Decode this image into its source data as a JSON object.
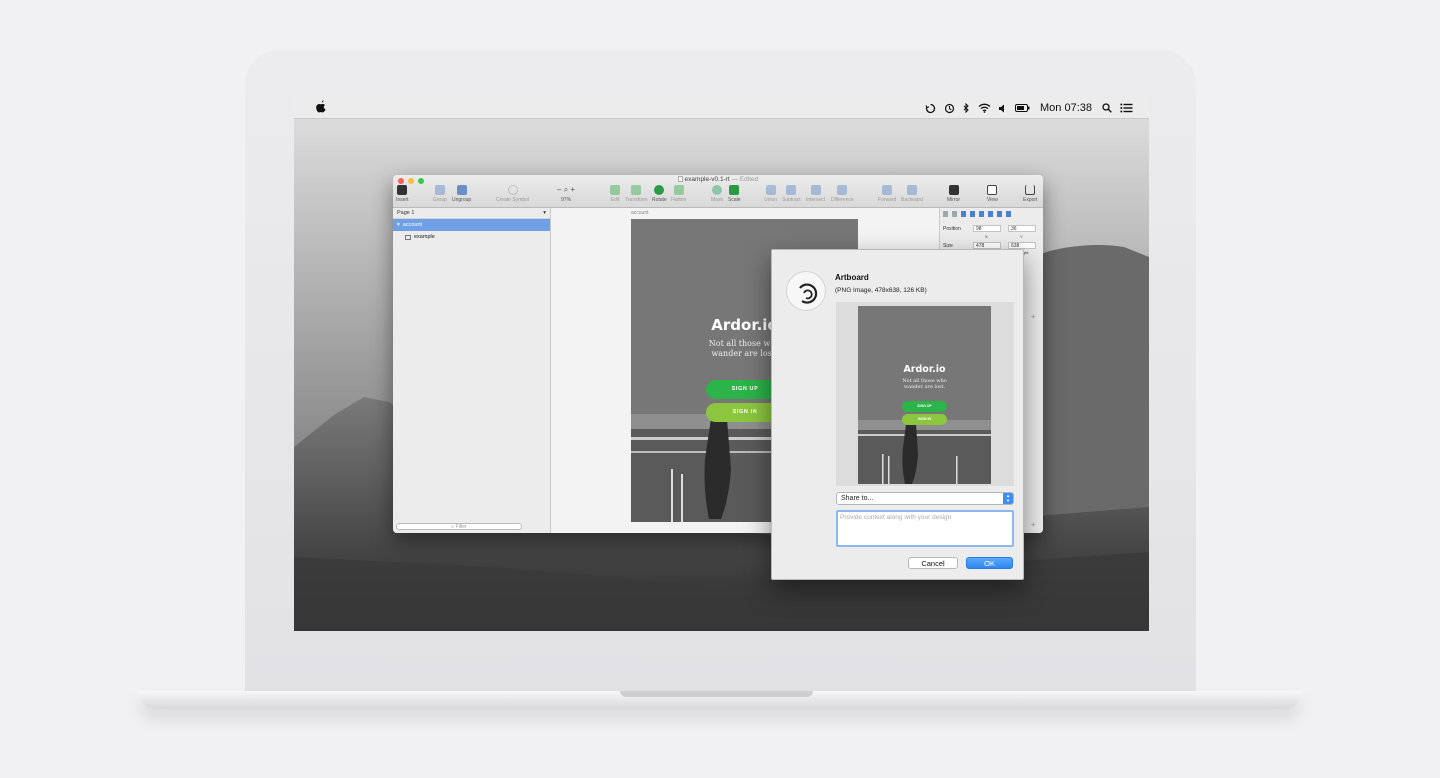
{
  "menubar": {
    "clock": "Mon 07:38"
  },
  "window": {
    "title": "example-v0.1-rt",
    "edited": "— Edited"
  },
  "toolbar": {
    "insert": "Insert",
    "group": "Group",
    "ungroup": "Ungroup",
    "create_symbol": "Create Symbol",
    "zoom_minus": "–",
    "zoom_plus": "+",
    "zoom_level": "97%",
    "edit": "Edit",
    "transform": "Transform",
    "rotate": "Rotate",
    "flatten": "Flatten",
    "mask": "Mask",
    "scale": "Scale",
    "union": "Union",
    "subtract": "Subtract",
    "intersect": "Intersect",
    "difference": "Difference",
    "forward": "Forward",
    "backward": "Backward",
    "mirror": "Mirror",
    "view": "View",
    "export": "Export"
  },
  "layers": {
    "page": "Page 1",
    "items": [
      {
        "label": "account"
      },
      {
        "label": "example"
      }
    ],
    "filter_placeholder": "Filter"
  },
  "canvas": {
    "artboard_label": "account",
    "app_title": "Ardor.io",
    "tagline_1": "Not all those who",
    "tagline_2": "wander are lost.",
    "signup": "SIGN UP",
    "signin": "SIGN IN"
  },
  "inspector": {
    "position_label": "Position",
    "pos_x": "98",
    "pos_y": "36",
    "x_label": "X",
    "y_label": "Y",
    "size_label": "Size",
    "width": "478",
    "height": "638",
    "height_label": "ight"
  },
  "dialog": {
    "name": "Artboard",
    "meta": "(PNG Image, 478x638, 126 KB)",
    "preview_title": "Ardor.io",
    "preview_tagline_1": "Not all those who",
    "preview_tagline_2": "wander are lost.",
    "preview_signup": "SIGN UP",
    "preview_signin": "SIGN IN",
    "share_value": "Share to...",
    "context_placeholder": "Provide context along with your design",
    "cancel": "Cancel",
    "ok": "OK"
  },
  "colors": {
    "signup_green": "#2cb34a",
    "signin_lime": "#8cc63f",
    "selection_blue": "#6fa0e6",
    "ok_blue": "#2f86f0"
  }
}
